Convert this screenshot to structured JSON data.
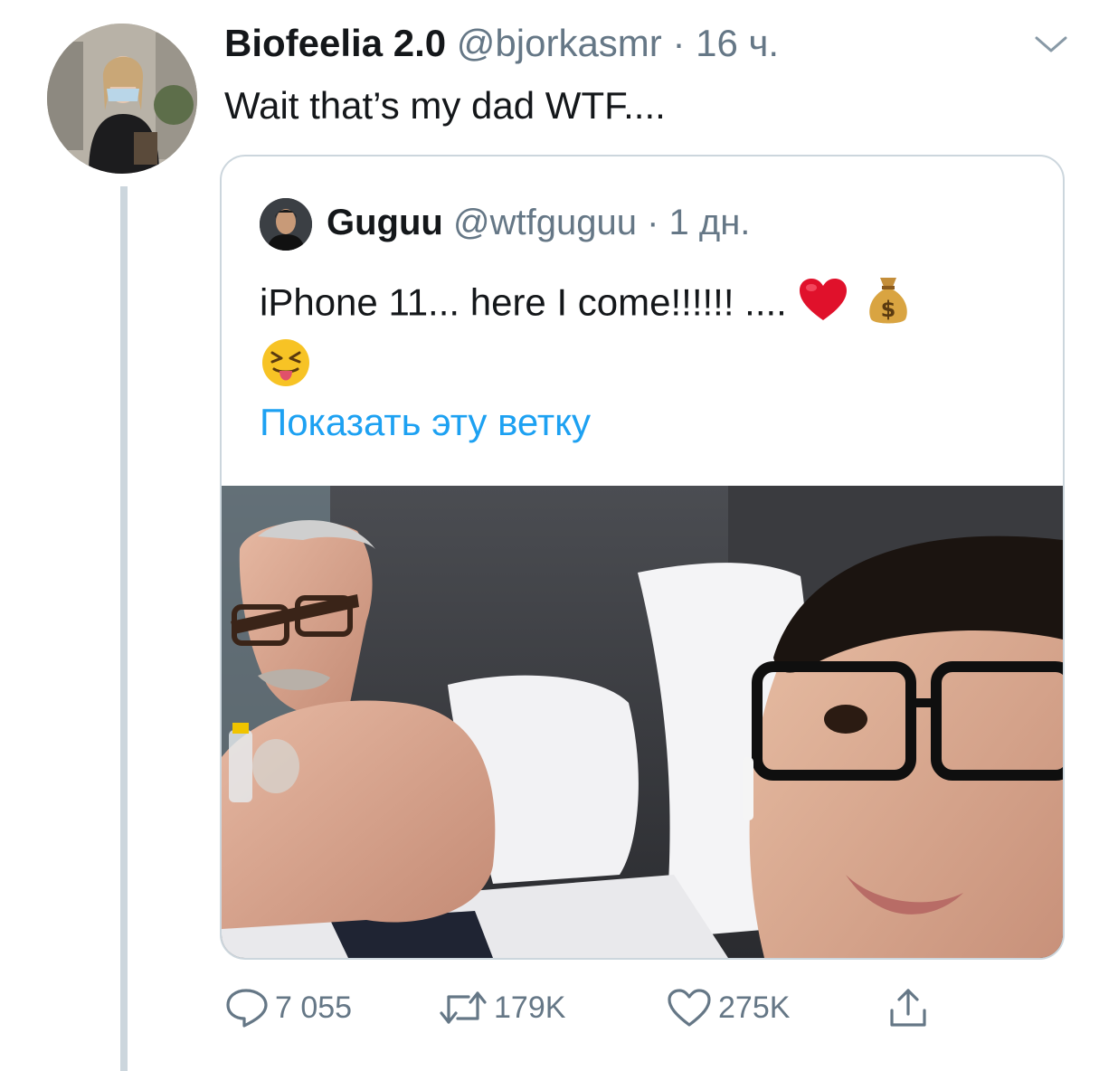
{
  "tweet": {
    "display_name": "Biofeelia 2.0",
    "handle": "@bjorkasmr",
    "separator": "·",
    "time": "16 ч.",
    "text": "Wait that’s my dad WTF....",
    "avatar_icon": "user-photo-avatar",
    "menu_icon": "chevron-down-icon"
  },
  "quoted_tweet": {
    "display_name": "Guguu",
    "handle": "@wtfguguu",
    "separator": "·",
    "time": "1 дн.",
    "text": "iPhone 11... here I come!!!!!!  ....",
    "emojis": [
      "red-heart-emoji",
      "money-bag-emoji",
      "squinting-face-with-tongue-emoji"
    ],
    "show_thread": "Показать эту ветку",
    "media_icon": "photo-image"
  },
  "actions": {
    "reply": {
      "icon": "reply-icon",
      "count": "7 055"
    },
    "retweet": {
      "icon": "retweet-icon",
      "count": "179K"
    },
    "like": {
      "icon": "heart-icon",
      "count": "275K"
    },
    "share": {
      "icon": "share-icon"
    }
  },
  "colors": {
    "text": "#14171a",
    "secondary": "#657786",
    "link": "#1da1f2",
    "border": "#ccd6dd",
    "heart_emoji": "#e0112b",
    "money_bag_emoji": "#d9a441"
  }
}
